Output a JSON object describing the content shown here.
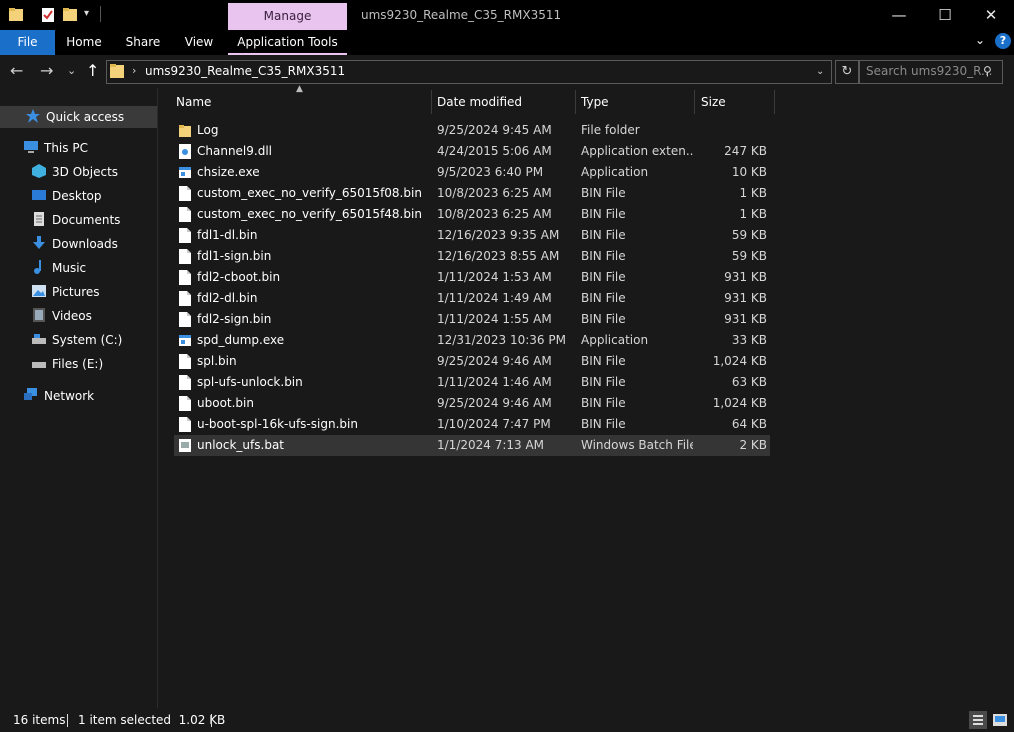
{
  "title_bar": {
    "window_title": "ums9230_Realme_C35_RMX3511",
    "manage_tab": "Manage",
    "minimize_glyph": "—",
    "maximize_glyph": "☐",
    "close_glyph": "✕"
  },
  "ribbon": {
    "tabs": [
      "File",
      "Home",
      "Share",
      "View",
      "Application Tools"
    ],
    "help_glyph": "?",
    "collapse_glyph": "⌄"
  },
  "address_bar": {
    "path": "ums9230_Realme_C35_RMX3511",
    "search_placeholder": "Search ums9230_R...",
    "back_glyph": "←",
    "forward_glyph": "→",
    "recent_glyph": "⌄",
    "up_glyph": "↑",
    "chevron_glyph": "›",
    "dropdown_glyph": "⌄",
    "refresh_glyph": "↻",
    "search_glyph": "⚲"
  },
  "nav_pane": {
    "quick_access": "Quick access",
    "this_pc": "This PC",
    "items": [
      "3D Objects",
      "Desktop",
      "Documents",
      "Downloads",
      "Music",
      "Pictures",
      "Videos",
      "System (C:)",
      "Files (E:)"
    ],
    "network": "Network"
  },
  "columns": {
    "name": "Name",
    "date": "Date modified",
    "type": "Type",
    "size": "Size"
  },
  "files": [
    {
      "name": "Log",
      "date": "9/25/2024 9:45 AM",
      "type": "File folder",
      "size": "",
      "icon": "folder-icon"
    },
    {
      "name": "Channel9.dll",
      "date": "4/24/2015 5:06 AM",
      "type": "Application exten...",
      "size": "247 KB",
      "icon": "dll-icon"
    },
    {
      "name": "chsize.exe",
      "date": "9/5/2023 6:40 PM",
      "type": "Application",
      "size": "10 KB",
      "icon": "exe-icon"
    },
    {
      "name": "custom_exec_no_verify_65015f08.bin",
      "date": "10/8/2023 6:25 AM",
      "type": "BIN File",
      "size": "1 KB",
      "icon": "file-icon"
    },
    {
      "name": "custom_exec_no_verify_65015f48.bin",
      "date": "10/8/2023 6:25 AM",
      "type": "BIN File",
      "size": "1 KB",
      "icon": "file-icon"
    },
    {
      "name": "fdl1-dl.bin",
      "date": "12/16/2023 9:35 AM",
      "type": "BIN File",
      "size": "59 KB",
      "icon": "file-icon"
    },
    {
      "name": "fdl1-sign.bin",
      "date": "12/16/2023 8:55 AM",
      "type": "BIN File",
      "size": "59 KB",
      "icon": "file-icon"
    },
    {
      "name": "fdl2-cboot.bin",
      "date": "1/11/2024 1:53 AM",
      "type": "BIN File",
      "size": "931 KB",
      "icon": "file-icon"
    },
    {
      "name": "fdl2-dl.bin",
      "date": "1/11/2024 1:49 AM",
      "type": "BIN File",
      "size": "931 KB",
      "icon": "file-icon"
    },
    {
      "name": "fdl2-sign.bin",
      "date": "1/11/2024 1:55 AM",
      "type": "BIN File",
      "size": "931 KB",
      "icon": "file-icon"
    },
    {
      "name": "spd_dump.exe",
      "date": "12/31/2023 10:36 PM",
      "type": "Application",
      "size": "33 KB",
      "icon": "exe-icon"
    },
    {
      "name": "spl.bin",
      "date": "9/25/2024 9:46 AM",
      "type": "BIN File",
      "size": "1,024 KB",
      "icon": "file-icon"
    },
    {
      "name": "spl-ufs-unlock.bin",
      "date": "1/11/2024 1:46 AM",
      "type": "BIN File",
      "size": "63 KB",
      "icon": "file-icon"
    },
    {
      "name": "uboot.bin",
      "date": "9/25/2024 9:46 AM",
      "type": "BIN File",
      "size": "1,024 KB",
      "icon": "file-icon"
    },
    {
      "name": "u-boot-spl-16k-ufs-sign.bin",
      "date": "1/10/2024 7:47 PM",
      "type": "BIN File",
      "size": "64 KB",
      "icon": "file-icon"
    },
    {
      "name": "unlock_ufs.bat",
      "date": "1/1/2024 7:13 AM",
      "type": "Windows Batch File",
      "size": "2 KB",
      "icon": "bat-icon",
      "selected": true
    }
  ],
  "status_bar": {
    "item_count": "16 items",
    "selection": "1 item selected  1.02 KB"
  },
  "colors": {
    "background": "#191919",
    "titlebar": "#000000",
    "file_tab": "#1a6fc9",
    "manage_tab": "#e8c4ee",
    "selected_row": "#353535",
    "folder": "#f4d27a"
  }
}
